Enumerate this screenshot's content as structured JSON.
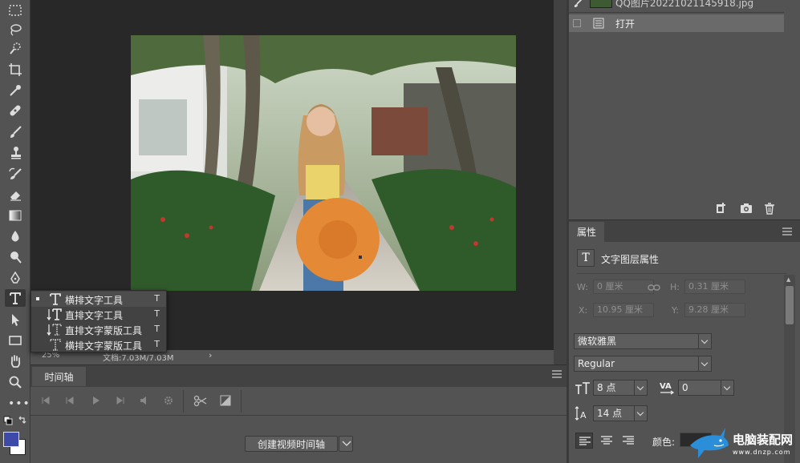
{
  "tools": [
    {
      "name": "marquee-icon"
    },
    {
      "name": "lasso-icon"
    },
    {
      "name": "quick-select-icon"
    },
    {
      "name": "crop-icon"
    },
    {
      "name": "eyedropper-icon"
    },
    {
      "name": "healing-brush-icon"
    },
    {
      "name": "brush-icon"
    },
    {
      "name": "clone-stamp-icon"
    },
    {
      "name": "history-brush-icon"
    },
    {
      "name": "eraser-icon"
    },
    {
      "name": "gradient-icon"
    },
    {
      "name": "blur-icon"
    },
    {
      "name": "dodge-icon"
    },
    {
      "name": "pen-icon"
    },
    {
      "name": "type-tool-icon"
    },
    {
      "name": "path-select-icon"
    },
    {
      "name": "rectangle-icon"
    },
    {
      "name": "hand-icon"
    },
    {
      "name": "zoom-icon"
    }
  ],
  "toolbar_more": "•••",
  "colors": {
    "foreground": "#3d4aa8",
    "background": "#ffffff",
    "panel": "#535353",
    "canvas_bg": "#282828"
  },
  "flyout": {
    "items": [
      {
        "label": "横排文字工具",
        "shortcut": "T",
        "selected": true
      },
      {
        "label": "直排文字工具",
        "shortcut": "T",
        "selected": false
      },
      {
        "label": "直排文字蒙版工具",
        "shortcut": "T",
        "selected": false
      },
      {
        "label": "横排文字蒙版工具",
        "shortcut": "T",
        "selected": false
      }
    ]
  },
  "status": {
    "zoom": "25%",
    "doc": "文档:7.03M/7.03M",
    "arrow": "›"
  },
  "timeline": {
    "tab": "时间轴",
    "create_button": "创建视频时间轴"
  },
  "history": {
    "snapshot_label": "QQ图片20221021145918.jpg",
    "rows": [
      {
        "label": "打开",
        "selected": true
      }
    ]
  },
  "properties": {
    "tab": "属性",
    "type_glyph": "T",
    "layer_type": "文字图层属性",
    "w_label": "W:",
    "w_value": "0 厘米",
    "h_label": "H:",
    "h_value": "0.31 厘米",
    "x_label": "X:",
    "x_value": "10.95 厘米",
    "y_label": "Y:",
    "y_value": "9.28 厘米",
    "font_family": "微软雅黑",
    "font_style": "Regular",
    "font_size": "8 点",
    "tracking": "0",
    "leading": "14 点",
    "color_label": "颜色:"
  },
  "watermark": {
    "text": "电脑装配网",
    "url": "www.dnzp.com"
  }
}
